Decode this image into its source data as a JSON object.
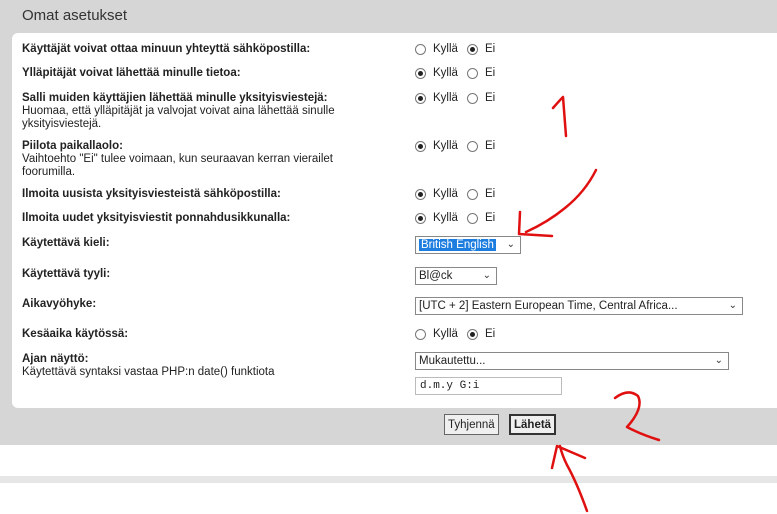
{
  "panel": {
    "title": "Omat asetukset"
  },
  "radio_labels": {
    "yes": "Kyllä",
    "no": "Ei"
  },
  "settings": [
    {
      "label": "Käyttäjät voivat ottaa minuun yhteyttä sähköpostilla:",
      "desc": "",
      "selected": "no"
    },
    {
      "label": "Ylläpitäjät voivat lähettää minulle tietoa:",
      "desc": "",
      "selected": "yes"
    },
    {
      "label": "Salli muiden käyttäjien lähettää minulle yksityisviestejä:",
      "desc": "Huomaa, että ylläpitäjät ja valvojat voivat aina lähettää sinulle yksityisviestejä.",
      "selected": "yes"
    },
    {
      "label": "Piilota paikallaolo:",
      "desc": "Vaihtoehto \"Ei\" tulee voimaan, kun seuraavan kerran vierailet foorumilla.",
      "selected": "yes"
    },
    {
      "label": "Ilmoita uusista yksityisviesteistä sähköpostilla:",
      "desc": "",
      "selected": "yes"
    },
    {
      "label": "Ilmoita uudet yksityisviestit ponnahdusikkunalla:",
      "desc": "",
      "selected": "yes"
    }
  ],
  "language": {
    "label": "Käytettävä kieli:",
    "value": "British English"
  },
  "style": {
    "label": "Käytettävä tyyli:",
    "value": "Bl@ck"
  },
  "timezone": {
    "label": "Aikavyöhyke:",
    "value": "[UTC + 2] Eastern European Time, Central Africa..."
  },
  "dst": {
    "label": "Kesäaika käytössä:",
    "selected": "no"
  },
  "date_format": {
    "label": "Ajan näyttö:",
    "desc": "Käytettävä syntaksi vastaa PHP:n date() funktiota",
    "select_value": "Mukautettu...",
    "input_value": "d.m.y  G:i"
  },
  "buttons": {
    "reset": "Tyhjennä",
    "submit": "Lähetä"
  },
  "annotations": {
    "mark_1": "1",
    "mark_2": "2",
    "color": "#e01010"
  },
  "colors": {
    "panel_bg": "#d6d6d6",
    "card_bg": "#ffffff",
    "highlight": "#1e7ee0"
  }
}
